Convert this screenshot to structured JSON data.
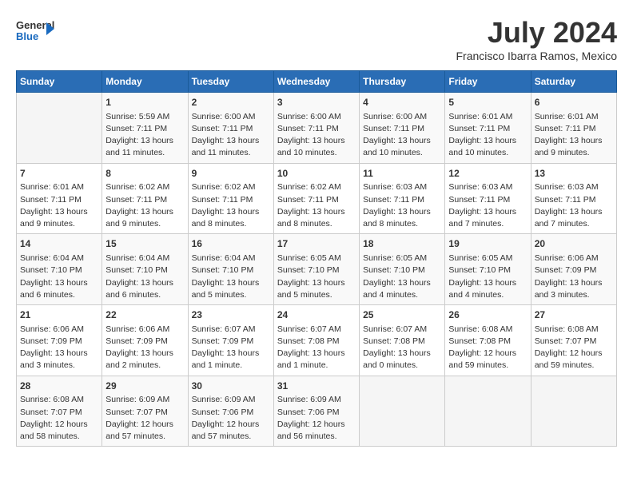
{
  "logo": {
    "general": "General",
    "blue": "Blue"
  },
  "header": {
    "month_year": "July 2024",
    "location": "Francisco Ibarra Ramos, Mexico"
  },
  "days_of_week": [
    "Sunday",
    "Monday",
    "Tuesday",
    "Wednesday",
    "Thursday",
    "Friday",
    "Saturday"
  ],
  "weeks": [
    [
      {
        "day": "",
        "info": ""
      },
      {
        "day": "1",
        "info": "Sunrise: 5:59 AM\nSunset: 7:11 PM\nDaylight: 13 hours\nand 11 minutes."
      },
      {
        "day": "2",
        "info": "Sunrise: 6:00 AM\nSunset: 7:11 PM\nDaylight: 13 hours\nand 11 minutes."
      },
      {
        "day": "3",
        "info": "Sunrise: 6:00 AM\nSunset: 7:11 PM\nDaylight: 13 hours\nand 10 minutes."
      },
      {
        "day": "4",
        "info": "Sunrise: 6:00 AM\nSunset: 7:11 PM\nDaylight: 13 hours\nand 10 minutes."
      },
      {
        "day": "5",
        "info": "Sunrise: 6:01 AM\nSunset: 7:11 PM\nDaylight: 13 hours\nand 10 minutes."
      },
      {
        "day": "6",
        "info": "Sunrise: 6:01 AM\nSunset: 7:11 PM\nDaylight: 13 hours\nand 9 minutes."
      }
    ],
    [
      {
        "day": "7",
        "info": "Sunrise: 6:01 AM\nSunset: 7:11 PM\nDaylight: 13 hours\nand 9 minutes."
      },
      {
        "day": "8",
        "info": "Sunrise: 6:02 AM\nSunset: 7:11 PM\nDaylight: 13 hours\nand 9 minutes."
      },
      {
        "day": "9",
        "info": "Sunrise: 6:02 AM\nSunset: 7:11 PM\nDaylight: 13 hours\nand 8 minutes."
      },
      {
        "day": "10",
        "info": "Sunrise: 6:02 AM\nSunset: 7:11 PM\nDaylight: 13 hours\nand 8 minutes."
      },
      {
        "day": "11",
        "info": "Sunrise: 6:03 AM\nSunset: 7:11 PM\nDaylight: 13 hours\nand 8 minutes."
      },
      {
        "day": "12",
        "info": "Sunrise: 6:03 AM\nSunset: 7:11 PM\nDaylight: 13 hours\nand 7 minutes."
      },
      {
        "day": "13",
        "info": "Sunrise: 6:03 AM\nSunset: 7:11 PM\nDaylight: 13 hours\nand 7 minutes."
      }
    ],
    [
      {
        "day": "14",
        "info": "Sunrise: 6:04 AM\nSunset: 7:10 PM\nDaylight: 13 hours\nand 6 minutes."
      },
      {
        "day": "15",
        "info": "Sunrise: 6:04 AM\nSunset: 7:10 PM\nDaylight: 13 hours\nand 6 minutes."
      },
      {
        "day": "16",
        "info": "Sunrise: 6:04 AM\nSunset: 7:10 PM\nDaylight: 13 hours\nand 5 minutes."
      },
      {
        "day": "17",
        "info": "Sunrise: 6:05 AM\nSunset: 7:10 PM\nDaylight: 13 hours\nand 5 minutes."
      },
      {
        "day": "18",
        "info": "Sunrise: 6:05 AM\nSunset: 7:10 PM\nDaylight: 13 hours\nand 4 minutes."
      },
      {
        "day": "19",
        "info": "Sunrise: 6:05 AM\nSunset: 7:10 PM\nDaylight: 13 hours\nand 4 minutes."
      },
      {
        "day": "20",
        "info": "Sunrise: 6:06 AM\nSunset: 7:09 PM\nDaylight: 13 hours\nand 3 minutes."
      }
    ],
    [
      {
        "day": "21",
        "info": "Sunrise: 6:06 AM\nSunset: 7:09 PM\nDaylight: 13 hours\nand 3 minutes."
      },
      {
        "day": "22",
        "info": "Sunrise: 6:06 AM\nSunset: 7:09 PM\nDaylight: 13 hours\nand 2 minutes."
      },
      {
        "day": "23",
        "info": "Sunrise: 6:07 AM\nSunset: 7:09 PM\nDaylight: 13 hours\nand 1 minute."
      },
      {
        "day": "24",
        "info": "Sunrise: 6:07 AM\nSunset: 7:08 PM\nDaylight: 13 hours\nand 1 minute."
      },
      {
        "day": "25",
        "info": "Sunrise: 6:07 AM\nSunset: 7:08 PM\nDaylight: 13 hours\nand 0 minutes."
      },
      {
        "day": "26",
        "info": "Sunrise: 6:08 AM\nSunset: 7:08 PM\nDaylight: 12 hours\nand 59 minutes."
      },
      {
        "day": "27",
        "info": "Sunrise: 6:08 AM\nSunset: 7:07 PM\nDaylight: 12 hours\nand 59 minutes."
      }
    ],
    [
      {
        "day": "28",
        "info": "Sunrise: 6:08 AM\nSunset: 7:07 PM\nDaylight: 12 hours\nand 58 minutes."
      },
      {
        "day": "29",
        "info": "Sunrise: 6:09 AM\nSunset: 7:07 PM\nDaylight: 12 hours\nand 57 minutes."
      },
      {
        "day": "30",
        "info": "Sunrise: 6:09 AM\nSunset: 7:06 PM\nDaylight: 12 hours\nand 57 minutes."
      },
      {
        "day": "31",
        "info": "Sunrise: 6:09 AM\nSunset: 7:06 PM\nDaylight: 12 hours\nand 56 minutes."
      },
      {
        "day": "",
        "info": ""
      },
      {
        "day": "",
        "info": ""
      },
      {
        "day": "",
        "info": ""
      }
    ]
  ]
}
